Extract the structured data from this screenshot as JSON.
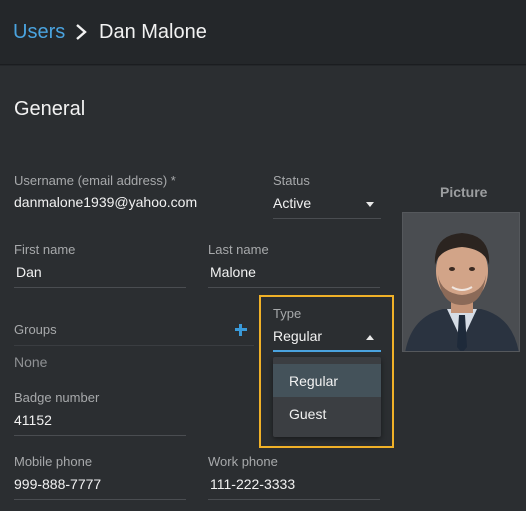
{
  "breadcrumb": {
    "parent": "Users",
    "current": "Dan Malone"
  },
  "section": {
    "title": "General"
  },
  "fields": {
    "username": {
      "label": "Username (email address) *",
      "value": "danmalone1939@yahoo.com"
    },
    "status": {
      "label": "Status",
      "value": "Active"
    },
    "first_name": {
      "label": "First name",
      "value": "Dan"
    },
    "last_name": {
      "label": "Last name",
      "value": "Malone"
    },
    "groups": {
      "label": "Groups",
      "value": "None"
    },
    "type": {
      "label": "Type",
      "value": "Regular",
      "options": [
        "Regular",
        "Guest"
      ]
    },
    "badge": {
      "label": "Badge number",
      "value": "41152"
    },
    "mobile": {
      "label": "Mobile phone",
      "value": "999-888-7777"
    },
    "work": {
      "label": "Work phone",
      "value": "111-222-3333"
    }
  },
  "picture": {
    "label": "Picture"
  },
  "colors": {
    "accent": "#4aa3df",
    "focus": "#f0b128",
    "background": "#2b2e31"
  }
}
